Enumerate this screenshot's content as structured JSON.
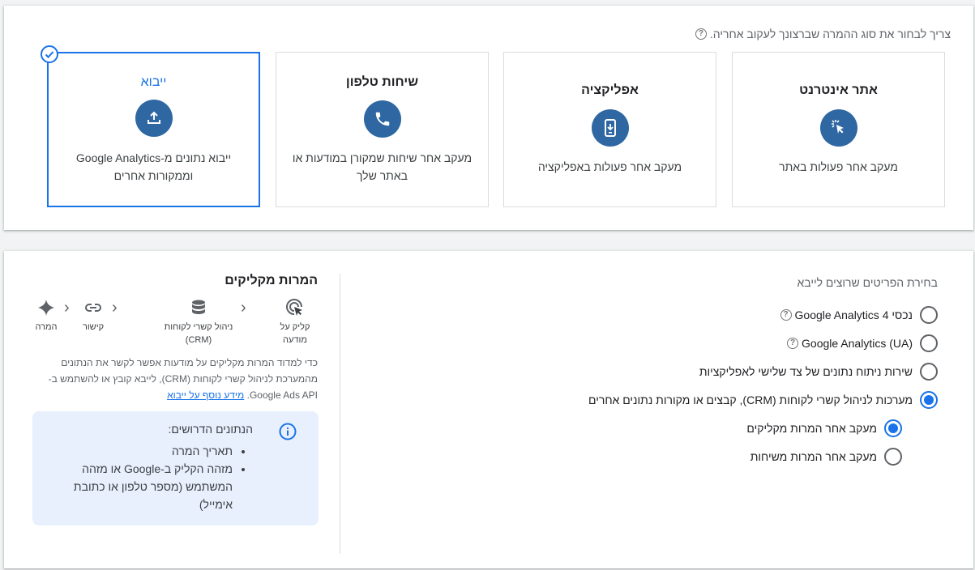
{
  "conversion_types": {
    "prompt": "צריך לבחור את סוג ההמרה שברצונך לעקוב אחריה.",
    "options": [
      {
        "title": "אתר אינטרנט",
        "description": "מעקב אחר פעולות באתר",
        "icon": "cursor-click-icon"
      },
      {
        "title": "אפליקציה",
        "description": "מעקב אחר פעולות באפליקציה",
        "icon": "smartphone-download-icon"
      },
      {
        "title": "שיחות טלפון",
        "description": "מעקב אחר שיחות שמקורן במודעות או באתר שלך",
        "icon": "phone-icon"
      },
      {
        "title": "ייבוא",
        "description": "ייבוא נתונים מ-Google Analytics וממקורות אחרים",
        "icon": "upload-icon",
        "selected": true
      }
    ]
  },
  "import_source": {
    "prompt": "בחירת הפריטים שרוצים לייבא",
    "options": [
      {
        "label": "נכסי Google Analytics 4",
        "selected": false,
        "help": true
      },
      {
        "label": "Google Analytics (UA)",
        "selected": false,
        "help": true
      },
      {
        "label": "שירות ניתוח נתונים של צד שלישי לאפליקציות",
        "selected": false
      },
      {
        "label": "מערכות לניהול קשרי לקוחות (CRM), קבצים או מקורות נתונים אחרים",
        "selected": true
      }
    ],
    "sub_options": [
      {
        "label": "מעקב אחר המרות מקליקים",
        "selected": true
      },
      {
        "label": "מעקב אחר המרות משיחות",
        "selected": false
      }
    ]
  },
  "side_panel": {
    "title": "המרות מקליקים",
    "flow": [
      {
        "label": "קליק על מודעה",
        "icon": "ad-click-icon"
      },
      {
        "label": "ניהול קשרי לקוחות (CRM)",
        "icon": "database-icon"
      },
      {
        "label": "קישור",
        "icon": "link-icon"
      },
      {
        "label": "המרה",
        "icon": "sparkle-icon"
      }
    ],
    "explanation": "כדי למדוד המרות מקליקים על מודעות אפשר לקשר את הנתונים מהמערכת לניהול קשרי לקוחות (CRM), לייבא קובץ או להשתמש ב-Google Ads API.",
    "learn_more": "מידע נוסף על ייבוא",
    "info": {
      "title": "הנתונים הדרושים:",
      "items": [
        "תאריך המרה",
        "מזהה הקליק ב-Google או מזהה המשתמש (מספר טלפון או כתובת אימייל)"
      ]
    }
  },
  "colors": {
    "accent": "#1a73e8",
    "icon_circle": "#2e67a2"
  }
}
